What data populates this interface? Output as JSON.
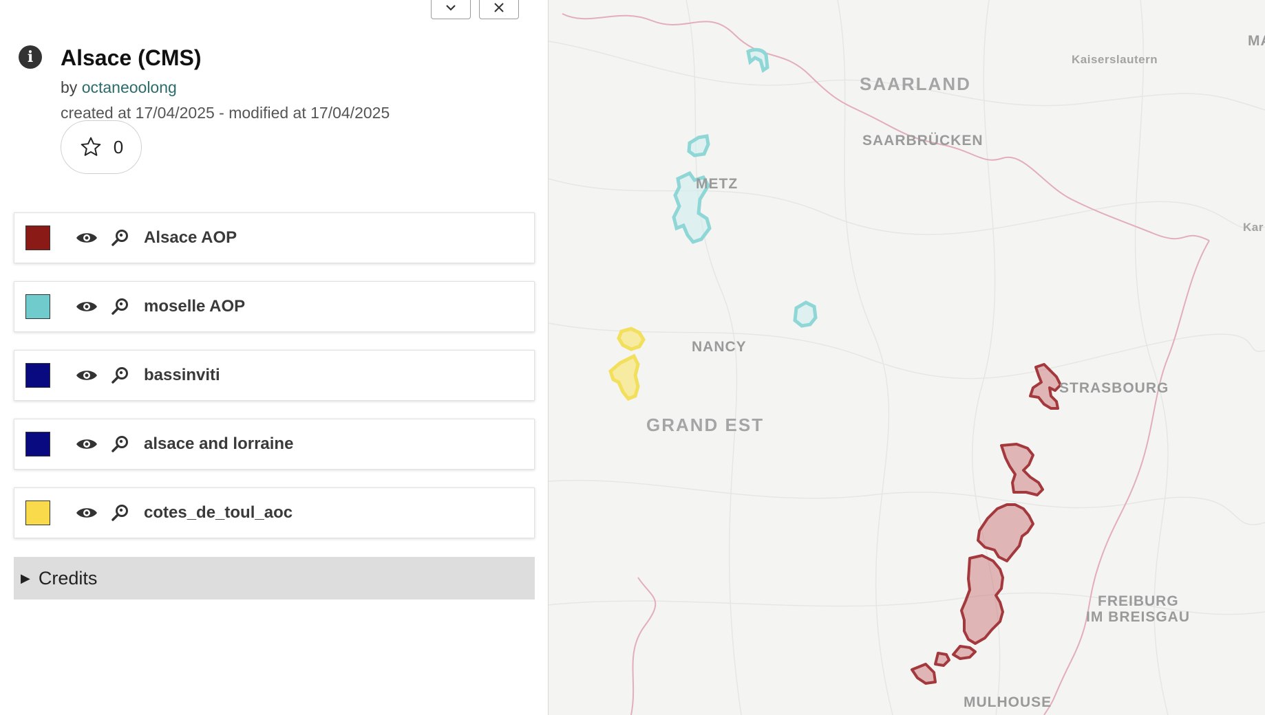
{
  "panel": {
    "title": "Alsace (CMS)",
    "by_label": "by",
    "author": "octaneoolong",
    "dates": "created at 17/04/2025 - modified at 17/04/2025",
    "star_count": "0",
    "icons": {
      "info": "info-icon",
      "star": "star-icon",
      "collapse": "chevron-down-icon",
      "close": "close-icon",
      "eye": "eye-icon",
      "zoom": "zoom-icon"
    }
  },
  "layers": [
    {
      "name": "Alsace AOP",
      "color": "#8a1a15"
    },
    {
      "name": "moselle AOP",
      "color": "#70cccc"
    },
    {
      "name": "bassinviti",
      "color": "#0a0a80"
    },
    {
      "name": "alsace and lorraine",
      "color": "#0a0a80"
    },
    {
      "name": "cotes_de_toul_aoc",
      "color": "#f9da4a"
    }
  ],
  "credits": {
    "arrow": "▶",
    "label": "Credits"
  },
  "map": {
    "labels": {
      "saarland": "SAARLAND",
      "saarbrucken": "SAARBRÜCKEN",
      "kaiserslautern": "Kaiserslautern",
      "metz": "METZ",
      "nancy": "NANCY",
      "grand_est": "GRAND EST",
      "strasbourg": "STRASBOURG",
      "freiburg1": "FREIBURG",
      "freiburg2": "IM BREISGAU",
      "mulhouse": "MULHOUSE",
      "edge_ma": "MA",
      "edge_kar": "Kar"
    },
    "colors": {
      "alsace_fill": "#c9767a",
      "alsace_stroke": "#a3383d",
      "moselle": "#8fd6d6",
      "toul": "#f2df5c",
      "border": "#e3b3bd"
    }
  }
}
